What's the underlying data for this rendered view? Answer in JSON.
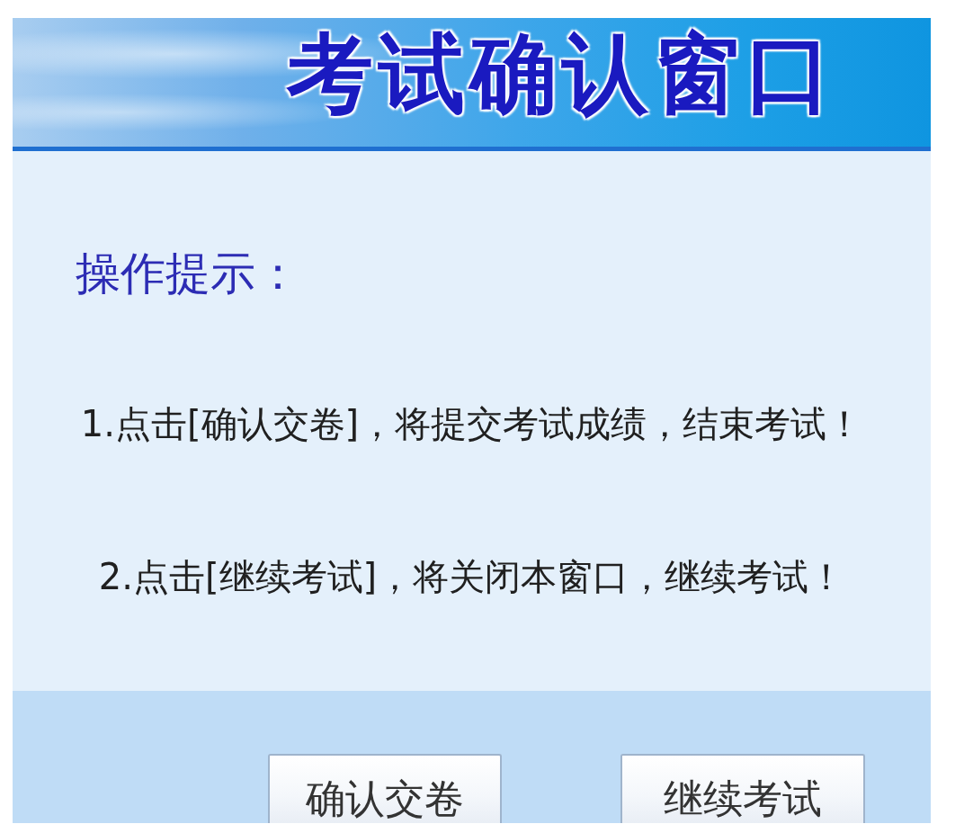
{
  "window": {
    "title": "考试确认窗口"
  },
  "instructions": {
    "heading": "操作提示：",
    "items": [
      "1.点击[确认交卷]，将提交考试成绩，结束考试！",
      "2.点击[继续考试]，将关闭本窗口，继续考试！"
    ]
  },
  "buttons": [
    {
      "label": "确认交卷"
    },
    {
      "label": "继续考试"
    }
  ]
}
